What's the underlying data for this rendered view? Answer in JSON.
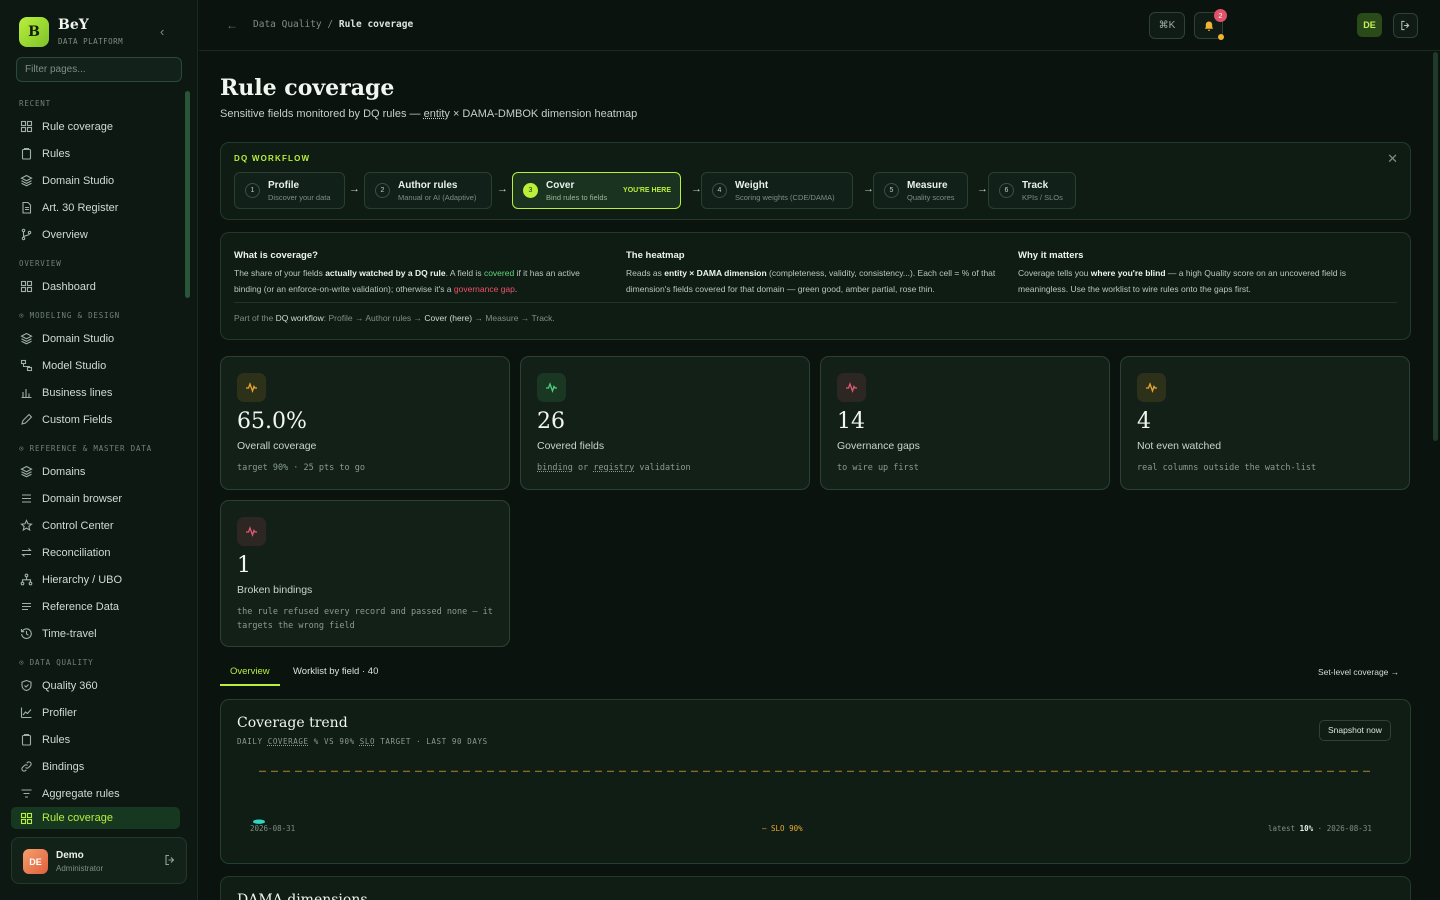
{
  "brand": {
    "name": "BeY",
    "logo_letter": "B",
    "subtitle": "DATA PLATFORM"
  },
  "sidebar": {
    "filter_placeholder": "Filter pages...",
    "sections": [
      {
        "title": "RECENT",
        "items": [
          {
            "label": "Rule coverage",
            "icon": "grid-icon"
          },
          {
            "label": "Rules",
            "icon": "clipboard-icon"
          },
          {
            "label": "Domain Studio",
            "icon": "layers-icon"
          },
          {
            "label": "Art. 30 Register",
            "icon": "document-icon"
          },
          {
            "label": "Overview",
            "icon": "branch-icon"
          }
        ]
      },
      {
        "title": "OVERVIEW",
        "items": [
          {
            "label": "Dashboard",
            "icon": "grid-icon"
          }
        ]
      },
      {
        "title": "⊙ MODELING & DESIGN",
        "items": [
          {
            "label": "Domain Studio",
            "icon": "layers-icon"
          },
          {
            "label": "Model Studio",
            "icon": "flow-icon"
          },
          {
            "label": "Business lines",
            "icon": "bar-chart-icon"
          },
          {
            "label": "Custom Fields",
            "icon": "pencil-icon"
          }
        ]
      },
      {
        "title": "⊙ REFERENCE & MASTER DATA",
        "items": [
          {
            "label": "Domains",
            "icon": "layers-icon"
          },
          {
            "label": "Domain browser",
            "icon": "list-icon"
          },
          {
            "label": "Control Center",
            "icon": "star-icon"
          },
          {
            "label": "Reconciliation",
            "icon": "swap-icon"
          },
          {
            "label": "Hierarchy / UBO",
            "icon": "hierarchy-icon"
          },
          {
            "label": "Reference Data",
            "icon": "lines-icon"
          },
          {
            "label": "Time-travel",
            "icon": "history-icon"
          }
        ]
      },
      {
        "title": "⊙ DATA QUALITY",
        "items": [
          {
            "label": "Quality 360",
            "icon": "shield-icon"
          },
          {
            "label": "Profiler",
            "icon": "trend-icon"
          },
          {
            "label": "Rules",
            "icon": "clipboard-icon"
          },
          {
            "label": "Bindings",
            "icon": "link-icon"
          },
          {
            "label": "Aggregate rules",
            "icon": "filter-icon"
          },
          {
            "label": "Rule coverage",
            "icon": "grid-icon",
            "active": true
          }
        ]
      }
    ]
  },
  "user": {
    "initials": "DE",
    "name": "Demo",
    "role": "Administrator"
  },
  "topbar": {
    "crumb_parent": "Data Quality",
    "crumb_sep": "/",
    "crumb_current": "Rule coverage",
    "shortcut_label": "⌘K",
    "notif_count": "2",
    "user_initials": "DE"
  },
  "page": {
    "title": "Rule coverage",
    "subtitle_pre": "Sensitive fields monitored by DQ rules — ",
    "subtitle_entity": "entity",
    "subtitle_post": " × DAMA-DMBOK dimension heatmap"
  },
  "workflow": {
    "label": "DQ WORKFLOW",
    "here_label": "YOU'RE HERE",
    "steps": [
      {
        "num": "1",
        "title": "Profile",
        "sub": "Discover your data"
      },
      {
        "num": "2",
        "title": "Author rules",
        "sub": "Manual or AI (Adaptive)"
      },
      {
        "num": "3",
        "title": "Cover",
        "sub": "Bind rules to fields",
        "current": true
      },
      {
        "num": "4",
        "title": "Weight",
        "sub": "Scoring weights (CDE/DAMA)"
      },
      {
        "num": "5",
        "title": "Measure",
        "sub": "Quality scores"
      },
      {
        "num": "6",
        "title": "Track",
        "sub": "KPIs / SLOs"
      }
    ]
  },
  "info": {
    "col1": {
      "heading": "What is coverage?",
      "t1": "The share of your fields ",
      "b1": "actually watched by a DQ rule",
      "t2": ". A field is ",
      "g1": "covered",
      "t3": " if it has an active binding (or an enforce-on-write validation); otherwise it's a ",
      "r1": "governance gap",
      "t4": "."
    },
    "col2": {
      "heading": "The heatmap",
      "t1": "Reads as ",
      "b1": "entity × DAMA dimension",
      "t2": " (completeness, validity, consistency...). Each cell = % of that dimension's fields covered for that domain — green good, amber partial, rose thin."
    },
    "col3": {
      "heading": "Why it matters",
      "t1": "Coverage tells you ",
      "b1": "where you're blind",
      "t2": " — a high Quality score on an uncovered field is meaningless. Use the worklist to wire rules onto the gaps first."
    },
    "footer_pre": "Part of the ",
    "footer_bold": "DQ workflow",
    "footer_mid": ": Profile → Author rules → ",
    "footer_here": "Cover (here)",
    "footer_post": " → Measure → Track."
  },
  "kpis": [
    {
      "value": "65.0%",
      "label": "Overall coverage",
      "detail": "target 90% · 25 pts to go",
      "tone": "#e6a830"
    },
    {
      "value": "26",
      "label": "Covered fields",
      "detail_a": "binding",
      "detail_b": " or ",
      "detail_c": "registry",
      "detail_d": " validation",
      "tone": "#4fd07a"
    },
    {
      "value": "14",
      "label": "Governance gaps",
      "detail": "to wire up first",
      "tone": "#e05a78"
    },
    {
      "value": "4",
      "label": "Not even watched",
      "detail": "real columns outside the watch-list",
      "tone": "#e6a830"
    },
    {
      "value": "1",
      "label": "Broken bindings",
      "detail": "the rule refused every record and passed none — it targets the wrong field",
      "tone": "#e05a78"
    }
  ],
  "tabs": [
    {
      "label": "Overview",
      "active": true
    },
    {
      "label": "Worklist by field · 40"
    }
  ],
  "set_level_link": "Set-level coverage →",
  "trend": {
    "title": "Coverage trend",
    "sub_pre": "DAILY ",
    "sub_cov": "COVERAGE",
    "sub_mid": " % VS 90% ",
    "sub_slo": "SLO",
    "sub_post": " TARGET · LAST 90 DAYS",
    "snapshot_label": "Snapshot now",
    "start_date": "2026-08-31",
    "slo_label": "— SLO 90%",
    "latest_pre": "latest ",
    "latest_value": "10%",
    "latest_post": " · 2026-08-31"
  },
  "chart_data": {
    "type": "line",
    "title": "Coverage trend",
    "x": [
      "2026-08-31"
    ],
    "series": [
      {
        "values": [
          10
        ]
      }
    ],
    "slo_target": 90,
    "ylim": [
      0,
      100
    ],
    "grid": false
  },
  "next_section_title": "DAMA dimensions"
}
